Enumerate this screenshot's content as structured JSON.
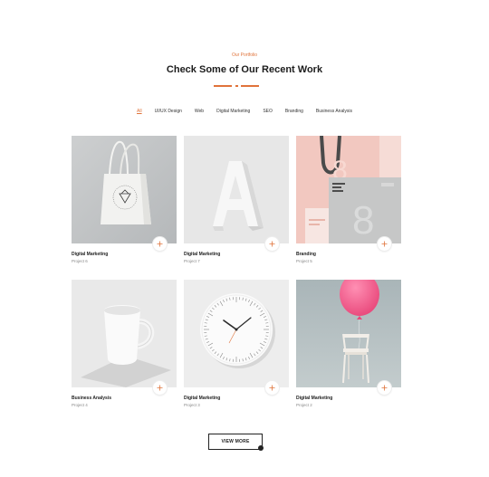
{
  "section": {
    "eyebrow": "Our Portfolio",
    "title": "Check Some of Our Recent Work",
    "accent_color": "#e0733a"
  },
  "filters": [
    "All",
    "UI/UX Design",
    "Web",
    "Digital Marketing",
    "SEO",
    "Branding",
    "Business Analysis"
  ],
  "active_filter": "All",
  "projects": [
    {
      "category": "Digital Marketing",
      "name": "Project 6",
      "image": "tote-bag"
    },
    {
      "category": "Digital Marketing",
      "name": "Project 7",
      "image": "letter-a-sculpture"
    },
    {
      "category": "Branding",
      "name": "Project 5",
      "image": "pink-stationery"
    },
    {
      "category": "Business Analysis",
      "name": "Project 4",
      "image": "white-mug"
    },
    {
      "category": "Digital Marketing",
      "name": "Project 3",
      "image": "wall-clock"
    },
    {
      "category": "Digital Marketing",
      "name": "Project 2",
      "image": "balloon-chair"
    }
  ],
  "buttons": {
    "view_more": "VIEW MORE",
    "open_icon": "plus-icon"
  }
}
